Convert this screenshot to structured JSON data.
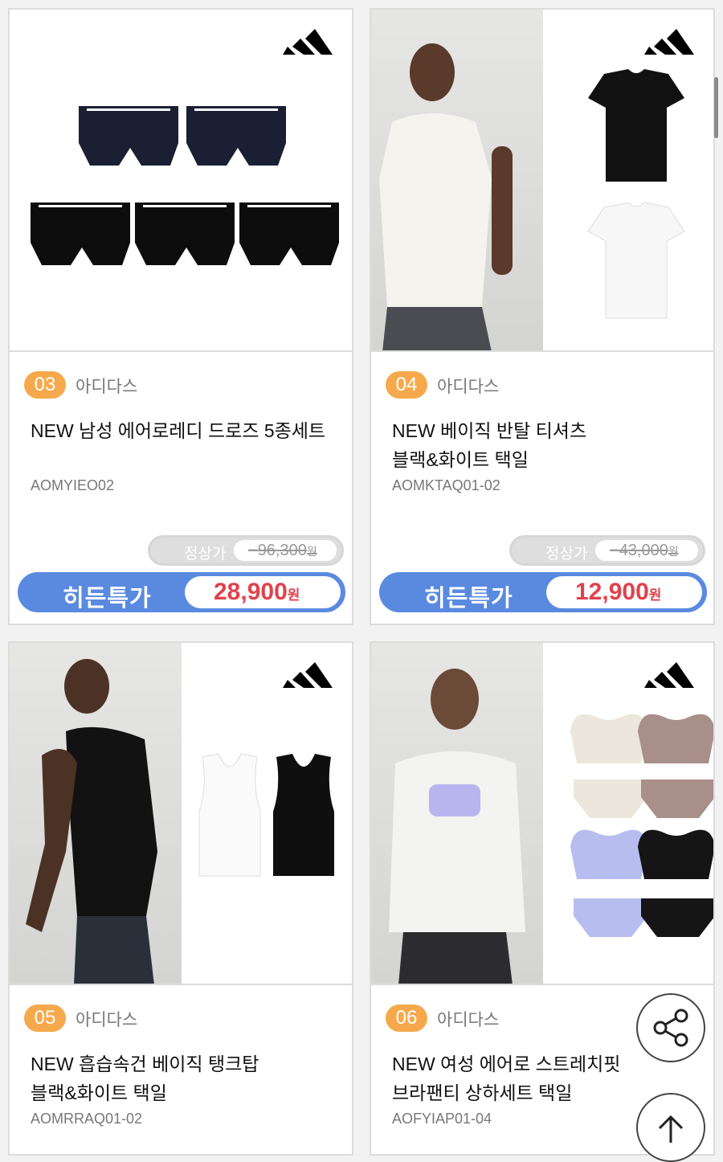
{
  "products": [
    {
      "number": "03",
      "brand": "아디다스",
      "name": "NEW 남성 에어로레디 드로즈 5종세트",
      "code": "AOMYIEO02",
      "regular_label": "정상가",
      "regular_price": "96,300",
      "won": "원",
      "hidden_label": "히든특가",
      "hidden_price": "28,900"
    },
    {
      "number": "04",
      "brand": "아디다스",
      "name_line1": "NEW 베이직 반탈 티셔츠",
      "name_line2": "블랙&화이트 택일",
      "code": "AOMKTAQ01-02",
      "regular_label": "정상가",
      "regular_price": "43,000",
      "won": "원",
      "hidden_label": "히든특가",
      "hidden_price": "12,900"
    },
    {
      "number": "05",
      "brand": "아디다스",
      "name_line1": "NEW 흡습속건 베이직 탱크탑",
      "name_line2": "블랙&화이트 택일",
      "code": "AOMRRAQ01-02"
    },
    {
      "number": "06",
      "brand": "아디다스",
      "name_line1": "NEW 여성 에어로 스트레치핏",
      "name_line2": "브라팬티 상하세트 택일",
      "code": "AOFYIAP01-04"
    }
  ],
  "colors": {
    "accent_orange": "#f6a94c",
    "hidden_blue": "#5a8ae0",
    "price_red": "#e0424d"
  },
  "icons": {
    "share": "share-icon",
    "top": "arrow-up-icon",
    "logo": "adidas-logo-icon"
  }
}
